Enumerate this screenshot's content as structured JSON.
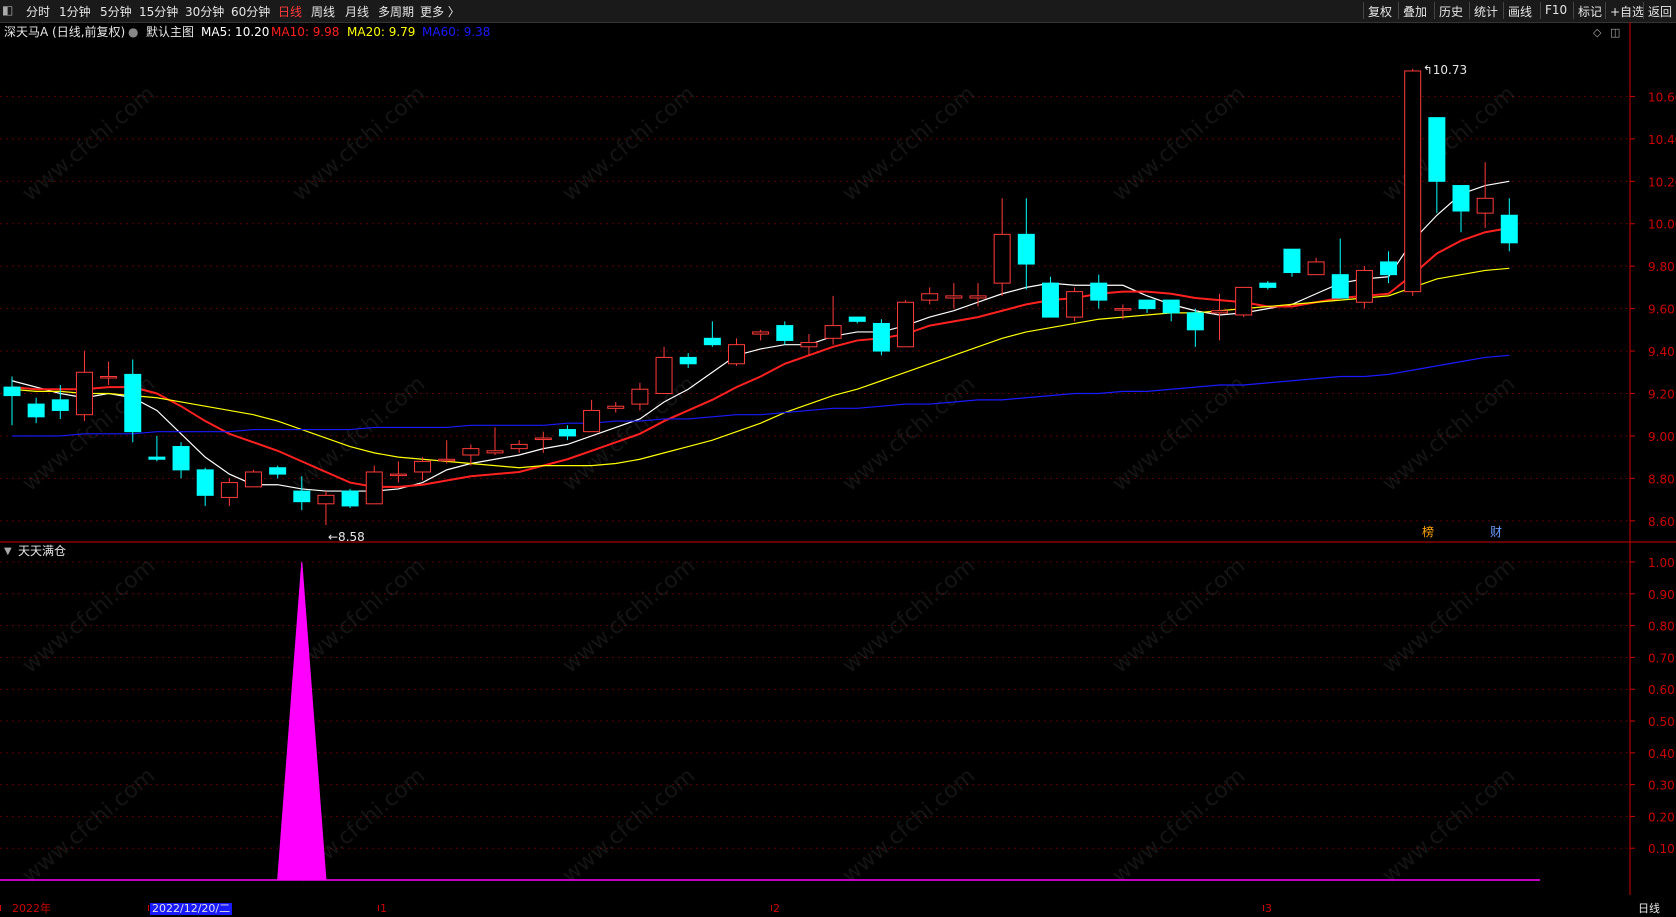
{
  "toolbar": {
    "left_icon": "◧",
    "periods": [
      "分时",
      "1分钟",
      "5分钟",
      "15分钟",
      "30分钟",
      "60分钟",
      "日线",
      "周线",
      "月线",
      "多周期",
      "更多 〉"
    ],
    "active_period": "日线",
    "right_buttons": [
      "复权",
      "叠加",
      "历史",
      "统计",
      "画线",
      "F10",
      "标记",
      "+自选",
      "返回"
    ]
  },
  "main_header": {
    "stock": "深天马A (日线,前复权)",
    "chart_name": "默认主图",
    "ma5": "MA5: 10.20",
    "ma10": "MA10: 9.98",
    "ma20": "MA20: 9.79",
    "ma60": "MA60: 9.38"
  },
  "sub_header": {
    "indicator": "天天满仓"
  },
  "annotations": {
    "high": "10.73",
    "low": "←8.58",
    "bang": "榜",
    "cai": "财"
  },
  "bottom_axis": {
    "labels": [
      {
        "text": "2022年",
        "color": "#cc0000"
      },
      {
        "text": "2022/12/20/二",
        "color": "#e0e0e0",
        "highlight": true
      },
      {
        "text": "1",
        "color": "#cc0000"
      },
      {
        "text": "2",
        "color": "#cc0000"
      },
      {
        "text": "3",
        "color": "#cc0000"
      }
    ],
    "period": "日线"
  },
  "watermark": "www.cfchi.com",
  "colors": {
    "up": "#ff3b3b",
    "down": "#00ffff",
    "ma5": "#ffffff",
    "ma10": "#ff2020",
    "ma20": "#ffff00",
    "ma60": "#1a1aff",
    "signal": "#ff00ff",
    "axis": "#cc0000"
  },
  "chart_data": [
    {
      "type": "candlestick",
      "title": "深天马A (日线,前复权)",
      "y_ticks": [
        8.6,
        8.8,
        9.0,
        9.2,
        9.4,
        9.6,
        9.8,
        10.0,
        10.2,
        10.4,
        10.6
      ],
      "ylim": [
        8.5,
        10.8
      ],
      "candles": [
        {
          "o": 9.23,
          "h": 9.28,
          "l": 9.05,
          "c": 9.19
        },
        {
          "o": 9.15,
          "h": 9.18,
          "l": 9.06,
          "c": 9.09
        },
        {
          "o": 9.17,
          "h": 9.24,
          "l": 9.08,
          "c": 9.12
        },
        {
          "o": 9.1,
          "h": 9.4,
          "l": 9.07,
          "c": 9.3
        },
        {
          "o": 9.28,
          "h": 9.35,
          "l": 9.24,
          "c": 9.28
        },
        {
          "o": 9.29,
          "h": 9.36,
          "l": 8.97,
          "c": 9.02
        },
        {
          "o": 8.9,
          "h": 9.0,
          "l": 8.88,
          "c": 8.89
        },
        {
          "o": 8.95,
          "h": 8.97,
          "l": 8.8,
          "c": 8.84
        },
        {
          "o": 8.84,
          "h": 8.85,
          "l": 8.67,
          "c": 8.72
        },
        {
          "o": 8.71,
          "h": 8.8,
          "l": 8.67,
          "c": 8.78
        },
        {
          "o": 8.76,
          "h": 8.84,
          "l": 8.76,
          "c": 8.83
        },
        {
          "o": 8.85,
          "h": 8.86,
          "l": 8.8,
          "c": 8.82
        },
        {
          "o": 8.74,
          "h": 8.81,
          "l": 8.65,
          "c": 8.69
        },
        {
          "o": 8.68,
          "h": 8.74,
          "l": 8.58,
          "c": 8.72
        },
        {
          "o": 8.74,
          "h": 8.75,
          "l": 8.66,
          "c": 8.67
        },
        {
          "o": 8.68,
          "h": 8.86,
          "l": 8.68,
          "c": 8.83
        },
        {
          "o": 8.82,
          "h": 8.88,
          "l": 8.78,
          "c": 8.82
        },
        {
          "o": 8.83,
          "h": 8.9,
          "l": 8.79,
          "c": 8.88
        },
        {
          "o": 8.89,
          "h": 8.98,
          "l": 8.87,
          "c": 8.89
        },
        {
          "o": 8.91,
          "h": 8.96,
          "l": 8.86,
          "c": 8.94
        },
        {
          "o": 8.92,
          "h": 9.04,
          "l": 8.91,
          "c": 8.93
        },
        {
          "o": 8.94,
          "h": 8.98,
          "l": 8.92,
          "c": 8.96
        },
        {
          "o": 8.99,
          "h": 9.02,
          "l": 8.92,
          "c": 8.99
        },
        {
          "o": 9.03,
          "h": 9.05,
          "l": 8.98,
          "c": 9.0
        },
        {
          "o": 9.02,
          "h": 9.17,
          "l": 9.02,
          "c": 9.12
        },
        {
          "o": 9.13,
          "h": 9.16,
          "l": 9.11,
          "c": 9.14
        },
        {
          "o": 9.15,
          "h": 9.25,
          "l": 9.12,
          "c": 9.22
        },
        {
          "o": 9.2,
          "h": 9.42,
          "l": 9.2,
          "c": 9.37
        },
        {
          "o": 9.37,
          "h": 9.39,
          "l": 9.32,
          "c": 9.34
        },
        {
          "o": 9.46,
          "h": 9.54,
          "l": 9.42,
          "c": 9.43
        },
        {
          "o": 9.34,
          "h": 9.46,
          "l": 9.33,
          "c": 9.43
        },
        {
          "o": 9.48,
          "h": 9.5,
          "l": 9.45,
          "c": 9.49
        },
        {
          "o": 9.52,
          "h": 9.54,
          "l": 9.43,
          "c": 9.45
        },
        {
          "o": 9.42,
          "h": 9.48,
          "l": 9.38,
          "c": 9.44
        },
        {
          "o": 9.46,
          "h": 9.66,
          "l": 9.43,
          "c": 9.52
        },
        {
          "o": 9.56,
          "h": 9.56,
          "l": 9.53,
          "c": 9.54
        },
        {
          "o": 9.53,
          "h": 9.55,
          "l": 9.38,
          "c": 9.4
        },
        {
          "o": 9.42,
          "h": 9.64,
          "l": 9.42,
          "c": 9.63
        },
        {
          "o": 9.64,
          "h": 9.7,
          "l": 9.62,
          "c": 9.67
        },
        {
          "o": 9.65,
          "h": 9.72,
          "l": 9.6,
          "c": 9.66
        },
        {
          "o": 9.65,
          "h": 9.72,
          "l": 9.61,
          "c": 9.66
        },
        {
          "o": 9.72,
          "h": 10.12,
          "l": 9.66,
          "c": 9.95
        },
        {
          "o": 9.95,
          "h": 10.12,
          "l": 9.69,
          "c": 9.81
        },
        {
          "o": 9.72,
          "h": 9.75,
          "l": 9.56,
          "c": 9.56
        },
        {
          "o": 9.56,
          "h": 9.7,
          "l": 9.54,
          "c": 9.68
        },
        {
          "o": 9.72,
          "h": 9.76,
          "l": 9.6,
          "c": 9.64
        },
        {
          "o": 9.6,
          "h": 9.62,
          "l": 9.55,
          "c": 9.6
        },
        {
          "o": 9.64,
          "h": 9.64,
          "l": 9.58,
          "c": 9.6
        },
        {
          "o": 9.64,
          "h": 9.64,
          "l": 9.54,
          "c": 9.58
        },
        {
          "o": 9.58,
          "h": 9.6,
          "l": 9.42,
          "c": 9.5
        },
        {
          "o": 9.58,
          "h": 9.67,
          "l": 9.45,
          "c": 9.59
        },
        {
          "o": 9.57,
          "h": 9.7,
          "l": 9.56,
          "c": 9.7
        },
        {
          "o": 9.72,
          "h": 9.73,
          "l": 9.69,
          "c": 9.7
        },
        {
          "o": 9.88,
          "h": 9.88,
          "l": 9.75,
          "c": 9.77
        },
        {
          "o": 9.76,
          "h": 9.84,
          "l": 9.76,
          "c": 9.82
        },
        {
          "o": 9.76,
          "h": 9.93,
          "l": 9.65,
          "c": 9.65
        },
        {
          "o": 9.63,
          "h": 9.8,
          "l": 9.6,
          "c": 9.78
        },
        {
          "o": 9.82,
          "h": 9.87,
          "l": 9.72,
          "c": 9.76
        },
        {
          "o": 9.68,
          "h": 10.73,
          "l": 9.66,
          "c": 10.72
        },
        {
          "o": 10.5,
          "h": 10.5,
          "l": 10.05,
          "c": 10.2
        },
        {
          "o": 10.18,
          "h": 10.18,
          "l": 9.96,
          "c": 10.06
        },
        {
          "o": 10.05,
          "h": 10.29,
          "l": 9.98,
          "c": 10.12
        },
        {
          "o": 10.04,
          "h": 10.12,
          "l": 9.87,
          "c": 9.91
        }
      ],
      "series": [
        {
          "name": "MA5",
          "values": [
            9.26,
            9.23,
            9.2,
            9.18,
            9.2,
            9.18,
            9.12,
            9.01,
            8.9,
            8.82,
            8.77,
            8.77,
            8.75,
            8.74,
            8.74,
            8.74,
            8.75,
            8.78,
            8.84,
            8.87,
            8.89,
            8.91,
            8.94,
            8.96,
            9.0,
            9.04,
            9.08,
            9.16,
            9.22,
            9.3,
            9.38,
            9.41,
            9.43,
            9.43,
            9.47,
            9.49,
            9.49,
            9.52,
            9.56,
            9.59,
            9.63,
            9.67,
            9.7,
            9.72,
            9.71,
            9.71,
            9.71,
            9.66,
            9.62,
            9.59,
            9.57,
            9.58,
            9.6,
            9.62,
            9.67,
            9.72,
            9.74,
            9.75,
            9.92,
            10.04,
            10.14,
            10.18,
            10.2
          ]
        },
        {
          "name": "MA10",
          "values": [
            9.23,
            9.22,
            9.22,
            9.22,
            9.23,
            9.23,
            9.2,
            9.14,
            9.07,
            9.01,
            8.97,
            8.93,
            8.88,
            8.83,
            8.78,
            8.76,
            8.76,
            8.77,
            8.79,
            8.81,
            8.82,
            8.83,
            8.86,
            8.89,
            8.93,
            8.97,
            9.01,
            9.07,
            9.12,
            9.17,
            9.23,
            9.28,
            9.34,
            9.38,
            9.42,
            9.45,
            9.46,
            9.48,
            9.52,
            9.54,
            9.56,
            9.59,
            9.62,
            9.64,
            9.65,
            9.67,
            9.68,
            9.68,
            9.67,
            9.65,
            9.64,
            9.63,
            9.61,
            9.61,
            9.63,
            9.65,
            9.66,
            9.67,
            9.76,
            9.86,
            9.92,
            9.96,
            9.98
          ]
        },
        {
          "name": "MA20",
          "values": [
            9.22,
            9.21,
            9.21,
            9.2,
            9.2,
            9.19,
            9.18,
            9.16,
            9.14,
            9.12,
            9.1,
            9.07,
            9.03,
            8.99,
            8.95,
            8.92,
            8.9,
            8.89,
            8.88,
            8.87,
            8.86,
            8.85,
            8.86,
            8.86,
            8.86,
            8.87,
            8.89,
            8.92,
            8.95,
            8.98,
            9.02,
            9.06,
            9.11,
            9.15,
            9.19,
            9.22,
            9.26,
            9.3,
            9.34,
            9.38,
            9.42,
            9.46,
            9.49,
            9.51,
            9.53,
            9.55,
            9.56,
            9.57,
            9.58,
            9.58,
            9.59,
            9.6,
            9.61,
            9.62,
            9.63,
            9.64,
            9.65,
            9.66,
            9.7,
            9.74,
            9.76,
            9.78,
            9.79
          ]
        },
        {
          "name": "MA60",
          "values": [
            9.0,
            9.0,
            9.0,
            9.01,
            9.01,
            9.01,
            9.02,
            9.02,
            9.02,
            9.02,
            9.03,
            9.03,
            9.03,
            9.03,
            9.03,
            9.04,
            9.04,
            9.04,
            9.04,
            9.05,
            9.05,
            9.05,
            9.05,
            9.06,
            9.06,
            9.07,
            9.07,
            9.08,
            9.08,
            9.09,
            9.1,
            9.1,
            9.11,
            9.12,
            9.13,
            9.13,
            9.14,
            9.15,
            9.15,
            9.16,
            9.17,
            9.17,
            9.18,
            9.19,
            9.2,
            9.2,
            9.21,
            9.21,
            9.22,
            9.23,
            9.24,
            9.24,
            9.25,
            9.26,
            9.27,
            9.28,
            9.28,
            9.29,
            9.31,
            9.33,
            9.35,
            9.37,
            9.38
          ]
        }
      ]
    },
    {
      "type": "area",
      "title": "天天满仓",
      "y_ticks": [
        0.1,
        0.2,
        0.3,
        0.4,
        0.5,
        0.6,
        0.7,
        0.8,
        0.9,
        1.0
      ],
      "ylim": [
        0,
        1.0
      ],
      "x": [
        11,
        12,
        13
      ],
      "values": [
        0,
        1.0,
        0
      ]
    }
  ]
}
